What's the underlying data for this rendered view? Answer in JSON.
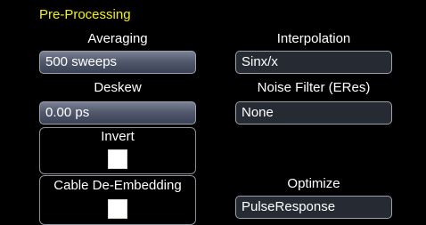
{
  "section": {
    "title": "Pre-Processing"
  },
  "averaging": {
    "label": "Averaging",
    "value": "500 sweeps"
  },
  "interpolation": {
    "label": "Interpolation",
    "value": "Sinx/x"
  },
  "deskew": {
    "label": "Deskew",
    "value": "0.00 ps"
  },
  "noise_filter": {
    "label": "Noise Filter (ERes)",
    "value": "None"
  },
  "invert": {
    "label": "Invert",
    "checked": false
  },
  "cable_de_embedding": {
    "label": "Cable De-Embedding",
    "checked": false
  },
  "optimize": {
    "label": "Optimize",
    "value": "PulseResponse"
  },
  "colors": {
    "title": "#f4f20e",
    "background": "#000000",
    "button": "#535a6e",
    "field": "#262a33",
    "border": "#9aa0ad"
  }
}
